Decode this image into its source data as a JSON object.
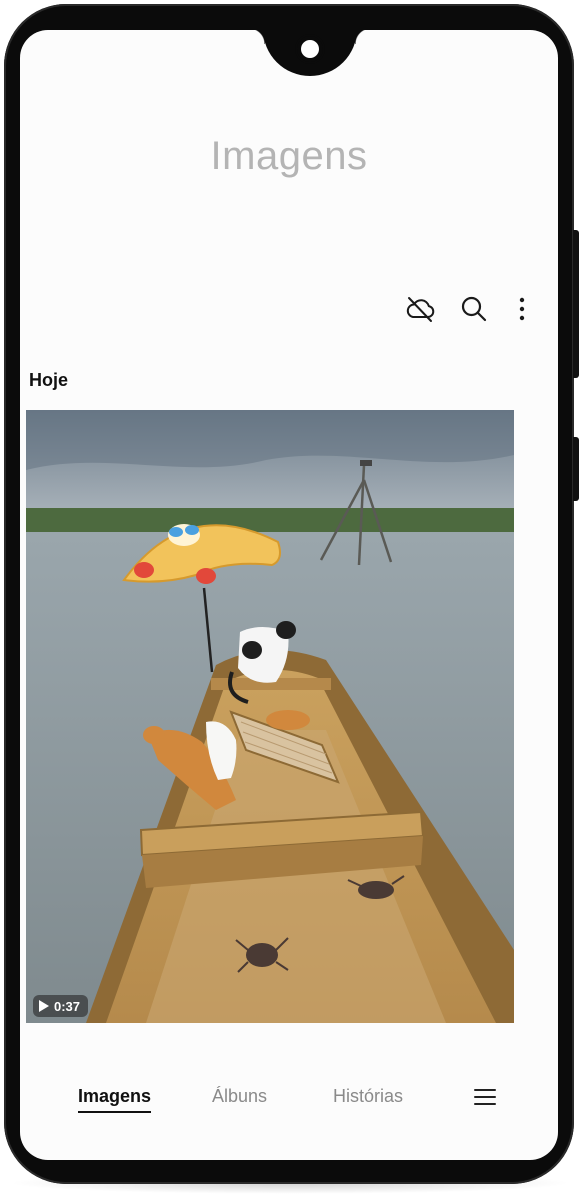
{
  "header": {
    "title": "Imagens"
  },
  "toolbar": {
    "icons": [
      "cloud-off-icon",
      "search-icon",
      "more-vertical-icon"
    ]
  },
  "gallery": {
    "section_label": "Hoje",
    "items": [
      {
        "type": "video",
        "duration": "0:37"
      }
    ]
  },
  "bottom_nav": {
    "tabs": [
      {
        "label": "Imagens",
        "active": true
      },
      {
        "label": "Álbuns",
        "active": false
      },
      {
        "label": "Histórias",
        "active": false
      }
    ],
    "menu_icon": "hamburger-menu-icon"
  },
  "colors": {
    "title_gray": "#b4b4b4",
    "active_tab": "#111111",
    "inactive_tab": "#8a8a8a",
    "phone_frame": "#0b0b0b"
  }
}
